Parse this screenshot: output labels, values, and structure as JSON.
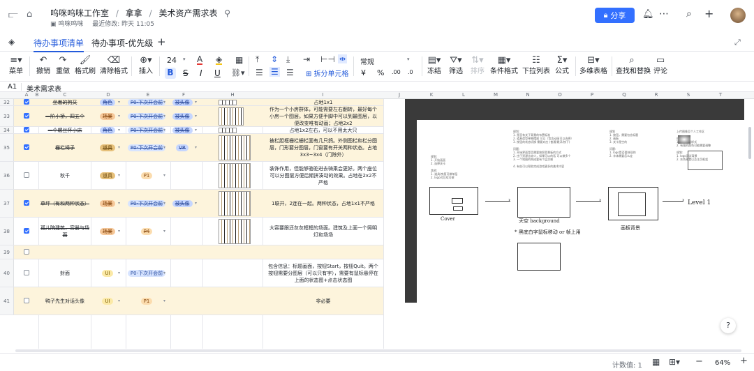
{
  "header": {
    "breadcrumb": [
      "呜咪呜咪工作室",
      "拿拿",
      "美术资产需求表"
    ],
    "owner": "呜咪呜咪",
    "last_modified": "最近修改: 昨天 11:05",
    "share_label": "分享"
  },
  "tabs": [
    {
      "label": "待办事项清单",
      "active": true
    },
    {
      "label": "待办事项-优先级",
      "active": false
    }
  ],
  "toolbar": {
    "menu": "菜单",
    "undo": "撤销",
    "redo": "重做",
    "format_painter": "格式刷",
    "clear_format": "清除格式",
    "insert": "插入",
    "font_size": "24",
    "bold": "B",
    "strike": "S",
    "italic": "I",
    "underline": "U",
    "merge": "拆分单元格",
    "number_format": "常规",
    "currency": "¥",
    "percent": "%",
    "decimal_dec": ".00",
    "decimal_inc": ".0",
    "freeze": "冻结",
    "filter": "筛选",
    "sort": "排序",
    "cond_format": "条件格式",
    "dropdown": "下拉列表",
    "formula": "公式",
    "pivot": "多维表格",
    "find_replace": "查找和替换",
    "comment": "评论"
  },
  "formula_bar": {
    "cell_ref": "A1",
    "value": "美术需求表"
  },
  "columns": [
    "A",
    "B",
    "C",
    "D",
    "E",
    "F",
    "G",
    "H",
    "I",
    "J",
    "K",
    "L",
    "M",
    "N",
    "O",
    "P",
    "Q",
    "R",
    "S",
    "T"
  ],
  "rows": [
    {
      "num": "32",
      "checked": true,
      "name": "坐着的狗又",
      "strike": true,
      "tag1": "角色",
      "tag2": "P0-下次开会前",
      "tag3": "被头像",
      "desc": "占地1x1",
      "yellow": true
    },
    {
      "num": "33",
      "checked": true,
      "name": "一阶小桥，四五个",
      "strike": true,
      "tag1": "场景",
      "tag2": "P0-下次开会前",
      "tag3": "被头像",
      "desc": "作为一个小房群体，可能需要左右翻转，最好每个小房一个图层。如果方便手脚中可以到最图层，以便改变唯有动画；占地2x2",
      "yellow": true
    },
    {
      "num": "34",
      "checked": true,
      "name": "一个螺丝怀小床",
      "strike": true,
      "tag1": "角色",
      "tag2": "P0-下次开会前",
      "tag3": "被头像",
      "desc": "占地1x2左右，可以不用太大只",
      "yellow": false
    },
    {
      "num": "35",
      "checked": true,
      "name": "栅栏椅子",
      "strike": true,
      "tag1": "道具",
      "tag2": "P0-下次开会前",
      "tag3": "VR",
      "desc": "被栏胆框栅栏栅栏面有几只鸽。外侧图栏和栏分图层，门形要分图层，门窗要有开关两种状态。占地3x3~3x4（门除外）",
      "yellow": true
    },
    {
      "num": "36",
      "checked": false,
      "name": "秋千",
      "strike": false,
      "tag1": "道具",
      "tag2": "P1",
      "tag3": "",
      "desc": "装饰作用，但能够骆驼进去骑乘会更好。两个座位可以分图层方便后期拼凑动的效果。占地在2x2不严格",
      "yellow": false
    },
    {
      "num": "37",
      "checked": true,
      "name": "草坪（有和两种状态）",
      "strike": true,
      "tag1": "场景",
      "tag2": "P0-下次开会前",
      "tag3": "被头像",
      "desc": "1联开，2连在一起。两种状态，占地1x1不严格",
      "yellow": true
    },
    {
      "num": "38",
      "checked": true,
      "name": "孤儿院建筑，容器与场面",
      "strike": true,
      "tag1": "场景",
      "tag2": "P4",
      "tag3": "",
      "desc": "大容要跟还灰灰框框的场面。建筑及上面一个照明灯和场场",
      "yellow": false
    },
    {
      "num": "39",
      "checked": false,
      "name": "",
      "strike": false,
      "tag1": "",
      "tag2": "",
      "tag3": "",
      "desc": "",
      "yellow": true
    },
    {
      "num": "40",
      "checked": false,
      "name": "封面",
      "strike": false,
      "tag1": "UI",
      "tag2": "P0-下次开会前",
      "tag3": "",
      "desc": "包含信息：标题画面，按钮Start，按钮Quit。两个按钮需要分图层（可以只有字），需要有鼠标悬停在上面的状态图+点击状态图",
      "yellow": false
    },
    {
      "num": "41",
      "checked": false,
      "name": "鸭子先生对话头像",
      "strike": false,
      "tag1": "UI",
      "tag2": "P1",
      "tag3": "",
      "desc": "非必要",
      "yellow": true
    }
  ],
  "preview": {
    "labels": [
      "Cover",
      "天空 background",
      "画板背景",
      "Level 1"
    ],
    "notes": [
      "* 黑底白字鼠标移动 or 帧上用"
    ]
  },
  "status": {
    "count_label": "计数值: 1",
    "zoom": "64%"
  },
  "colors": {
    "accent": "#245bdb",
    "share_bg": "#3370ff",
    "yellow_row": "#fdf4dc"
  }
}
